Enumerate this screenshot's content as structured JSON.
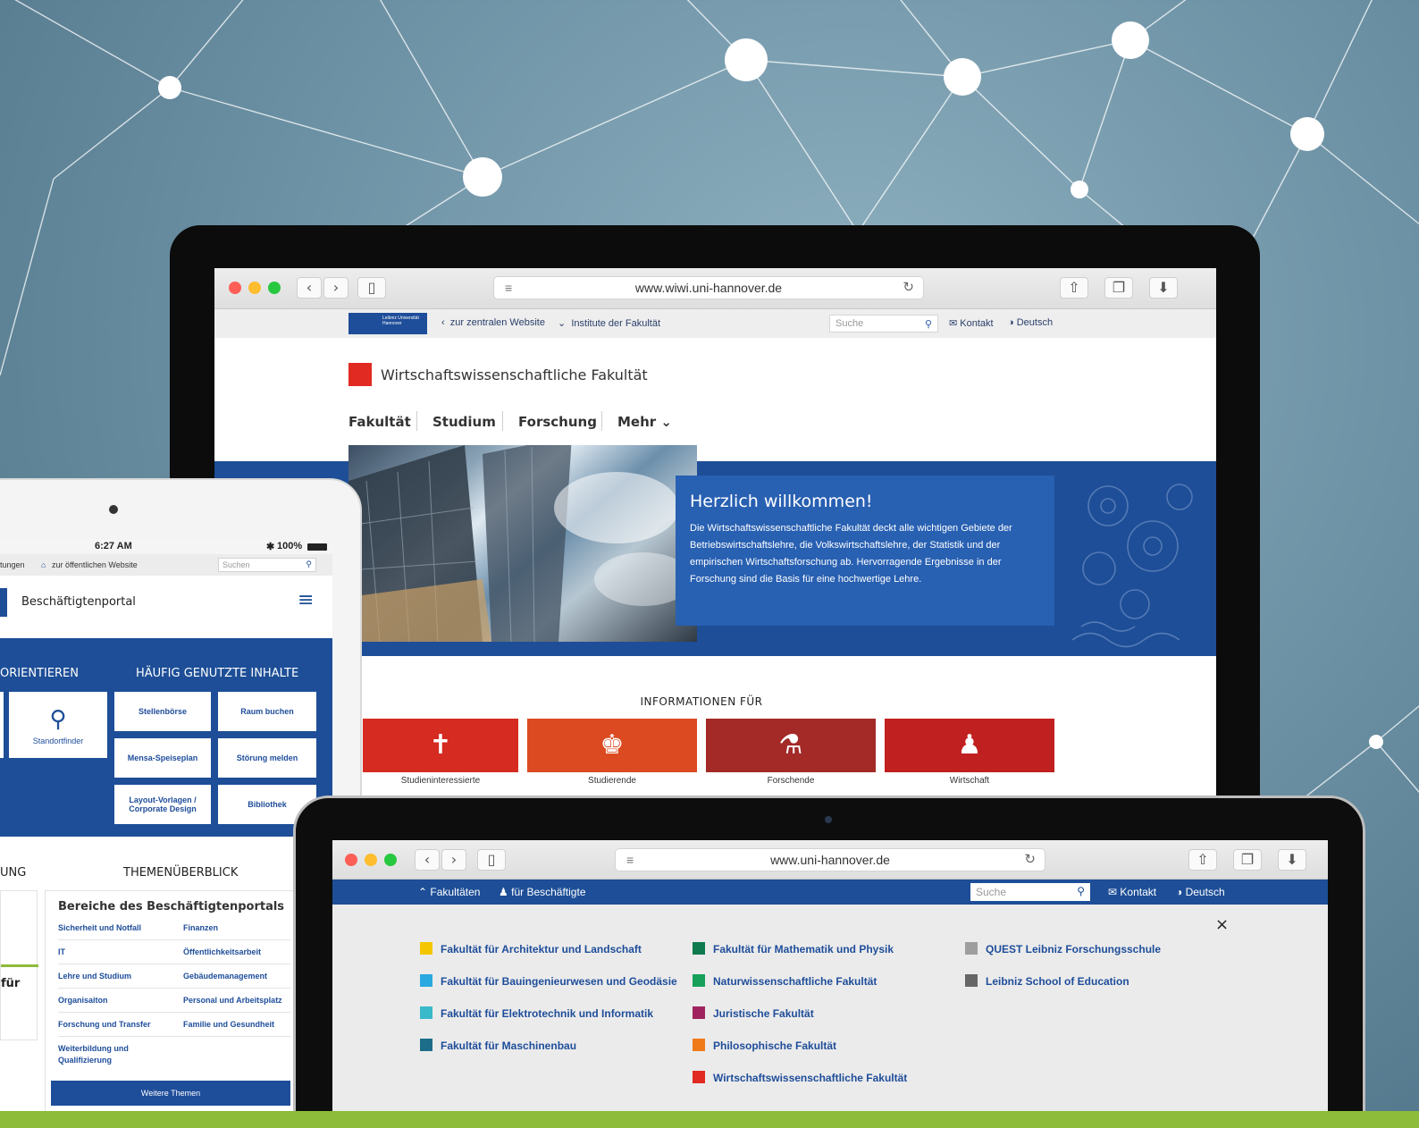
{
  "colors": {
    "uni_blue": "#1d4e97",
    "accent_red": "#e02a22",
    "tile_1": "#d62b21",
    "tile_2": "#dc4a21",
    "tile_3": "#a32a27",
    "tile_4": "#c0201f",
    "green_strip": "#8dbb3a"
  },
  "laptop": {
    "url": "www.wiwi.uni-hannover.de",
    "topbar": {
      "back_link": "zur zentralen Website",
      "institutes": "Institute der Fakultät",
      "search_placeholder": "Suche",
      "contact": "Kontakt",
      "language": "Deutsch"
    },
    "faculty_title": "Wirtschaftswissenschaftliche Fakultät",
    "nav": [
      "Fakultät",
      "Studium",
      "Forschung",
      "Mehr"
    ],
    "hero": {
      "title": "Herzlich willkommen!",
      "text": "Die Wirtschaftswissenschaftliche Fakultät deckt alle wichtigen Gebiete der Betriebswirtschaftslehre, die Volkswirtschaftslehre, der Statistik und der empirischen Wirtschaftsforschung ab. Hervorragende Ergebnisse in der Forschung sind die Basis für eine hochwertige Lehre."
    },
    "info_title": "INFORMATIONEN FÜR",
    "tiles": [
      {
        "label": "Studieninteressierte",
        "icon": "signpost-icon"
      },
      {
        "label": "Studierende",
        "icon": "student-icon"
      },
      {
        "label": "Forschende",
        "icon": "flask-icon"
      },
      {
        "label": "Wirtschaft",
        "icon": "business-person-icon"
      }
    ]
  },
  "tablet": {
    "time": "6:27 AM",
    "battery": "100%",
    "topbar_left": "tungen",
    "topbar_public": "zur öffentlichen Website",
    "search_placeholder": "Suchen",
    "portal_title": "Beschäftigtenportal",
    "col_orient": "ORIENTIEREN",
    "col_frequent": "HÄUFIG GENUTZTE INHALTE",
    "standortfinder": "Standortfinder",
    "quick_links": [
      "Stellenbörse",
      "Raum buchen",
      "Mensa-Speiseplan",
      "Störung melden",
      "Layout-Vorlagen / Corporate Design",
      "Bibliothek"
    ],
    "section_left": "UNG",
    "section_right": "THEMENÜBERBLICK",
    "card_title": "Bereiche des Beschäftigtenportals",
    "areas_left": [
      "Sicherheit und Notfall",
      "IT",
      "Lehre und Studium",
      "Organisaiton",
      "Forschung und Transfer",
      "Weiterbildung und Qualifizierung"
    ],
    "areas_right": [
      "Finanzen",
      "Öffentlichkeitsarbeit",
      "Gebäudemanagement",
      "Personal und Arbeitsplatz",
      "Familie und Gesundheit"
    ],
    "more_button": "Weitere Themen",
    "left_fragment": "für"
  },
  "laptop2": {
    "url": "www.uni-hannover.de",
    "nav_faculties": "Fakultäten",
    "nav_employees": "für Beschäftigte",
    "search_placeholder": "Suche",
    "contact": "Kontakt",
    "language": "Deutsch",
    "close": "×",
    "faculties": [
      {
        "name": "Fakultät für Architektur und Landschaft",
        "color": "#f4c600"
      },
      {
        "name": "Fakultät für Bauingenieurwesen und Geodäsie",
        "color": "#2aa8e0"
      },
      {
        "name": "Fakultät für Elektrotechnik und Informatik",
        "color": "#39b9c9"
      },
      {
        "name": "Fakultät für Maschinenbau",
        "color": "#1b6d8a"
      },
      {
        "name": "Fakultät für Mathematik und Physik",
        "color": "#0f7a4e"
      },
      {
        "name": "Naturwissenschaftliche Fakultät",
        "color": "#16a05a"
      },
      {
        "name": "Juristische Fakultät",
        "color": "#a0235f"
      },
      {
        "name": "Philosophische Fakultät",
        "color": "#f07a18"
      },
      {
        "name": "Wirtschaftswissenschaftliche Fakultät",
        "color": "#e02a22"
      },
      {
        "name": "QUEST Leibniz Forschungsschule",
        "color": "#9e9e9e"
      },
      {
        "name": "Leibniz School of Education",
        "color": "#666666"
      }
    ]
  }
}
